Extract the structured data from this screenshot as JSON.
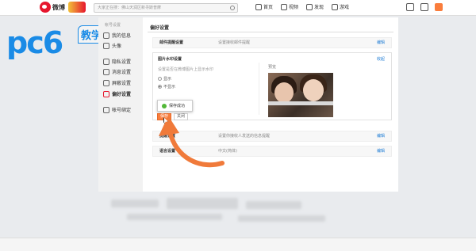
{
  "header": {
    "logo_text": "微博",
    "search_placeholder": "大家正在搜：佛山天润区新寻斯普摩",
    "nav": [
      {
        "label": "首页",
        "icon": "home-icon"
      },
      {
        "label": "视频",
        "icon": "video-icon"
      },
      {
        "label": "发现",
        "icon": "discover-icon"
      },
      {
        "label": "游戏",
        "icon": "game-icon"
      }
    ]
  },
  "watermark": {
    "text": "pc6",
    "badge": "教学"
  },
  "sidebar": {
    "title": "帐号设置",
    "items": [
      {
        "label": "我的信息",
        "icon": "user-icon"
      },
      {
        "label": "头像",
        "icon": "avatar-icon"
      },
      {
        "label": "隐私设置",
        "icon": "lock-icon"
      },
      {
        "label": "消息设置",
        "icon": "message-icon"
      },
      {
        "label": "屏蔽设置",
        "icon": "block-icon"
      },
      {
        "label": "偏好设置",
        "icon": "preference-icon"
      },
      {
        "label": "帐号绑定",
        "icon": "link-icon"
      }
    ]
  },
  "main": {
    "title": "偏好设置",
    "rows": [
      {
        "name": "邮件提醒设置",
        "desc": "设置接收邮件提醒",
        "edit": "编辑"
      },
      {
        "name": "提醒设置",
        "desc": "设置你接收人发送的信息提醒",
        "edit": "编辑"
      },
      {
        "name": "语言设置",
        "desc": "中文(简体)",
        "edit": "编辑"
      }
    ],
    "panel": {
      "title": "图片水印设置",
      "collapse": "收起",
      "desc": "设置是否在微博图片上显示水印",
      "options": [
        "显示",
        "不显示"
      ],
      "selected": "不显示",
      "preview_label": "预览",
      "toast": "保存成功",
      "save": "保存",
      "close": "关闭"
    }
  },
  "colors": {
    "brand": "#e6162d",
    "accent": "#fa7d3c",
    "link": "#1a7ad4"
  }
}
